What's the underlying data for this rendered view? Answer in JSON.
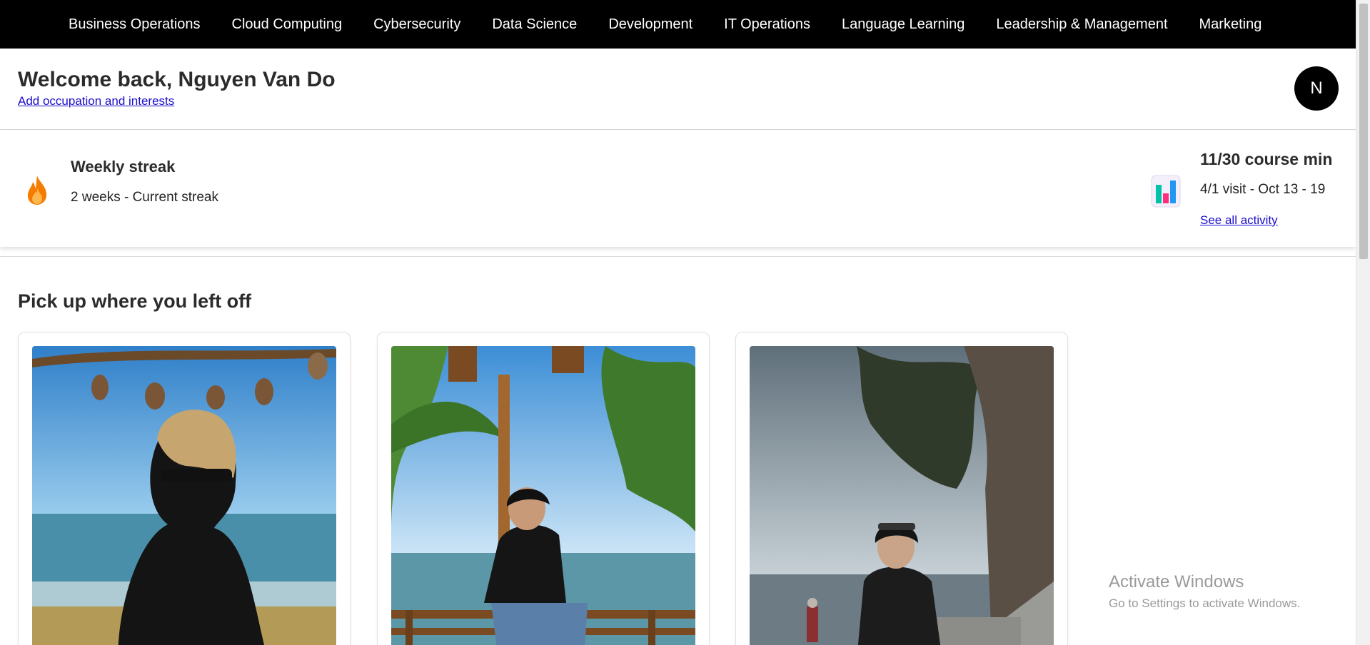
{
  "nav": {
    "items": [
      "Business Operations",
      "Cloud Computing",
      "Cybersecurity",
      "Data Science",
      "Development",
      "IT Operations",
      "Language Learning",
      "Leadership & Management",
      "Marketing"
    ]
  },
  "welcome": {
    "title": "Welcome back, Nguyen Van Do",
    "link": "Add occupation and interests",
    "avatar_initial": "N"
  },
  "streak": {
    "title": "Weekly streak",
    "subtitle": "2 weeks - Current streak",
    "icon": "flame-icon"
  },
  "stats": {
    "title": "11/30 course min",
    "subtitle": "4/1 visit - Oct 13 - 19",
    "link": "See all activity",
    "icon": "bar-chart-icon"
  },
  "continue": {
    "title": "Pick up where you left off",
    "cards": [
      {
        "image": "beach-photo-back-view"
      },
      {
        "image": "beach-photo-sitting-railing"
      },
      {
        "image": "beach-photo-sitting-steps"
      }
    ]
  },
  "watermark": {
    "title": "Activate Windows",
    "subtitle": "Go to Settings to activate Windows."
  },
  "colors": {
    "nav_bg": "#000000",
    "link": "#1a0dcc",
    "flame": "#f57c00"
  }
}
